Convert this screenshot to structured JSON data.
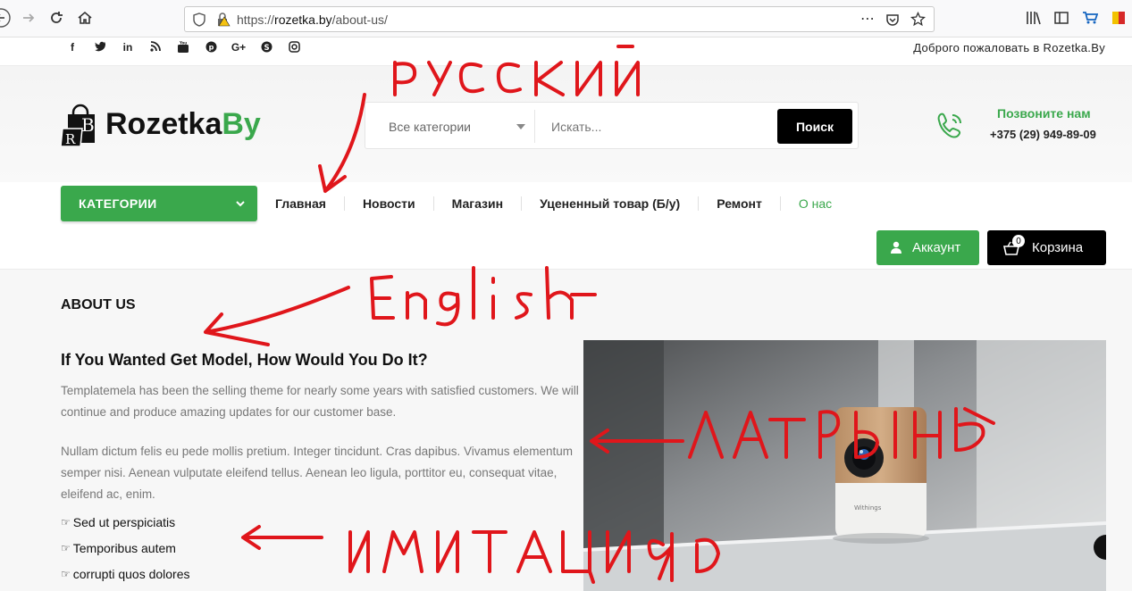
{
  "browser": {
    "url_prefix": "https://",
    "url_host": "rozetka.by",
    "url_path": "/about-us/",
    "more_icon": "⋯"
  },
  "topbar": {
    "social": [
      "f",
      "t",
      "in",
      "rss",
      "yt",
      "p",
      "G+",
      "s",
      "ig"
    ],
    "welcome": "Доброго пожаловать в Rozetka.By"
  },
  "header": {
    "logo_main": "Rozetka",
    "logo_accent": "By",
    "logo_bag_letters": [
      "R",
      "B"
    ],
    "search": {
      "category": "Все категории",
      "placeholder": "Искать...",
      "button": "Поиск"
    },
    "call_label": "Позвоните нам",
    "phone": "+375 (29) 949-89-09"
  },
  "nav": {
    "categories": "КАТЕГОРИИ",
    "items": [
      "Главная",
      "Новости",
      "Магазин",
      "Уцененный товар (Б/у)",
      "Ремонт",
      "О нас"
    ],
    "account": "Аккаунт",
    "cart": "Корзина",
    "cart_count": "0"
  },
  "content": {
    "section_title": "ABOUT US",
    "heading": "If You Wanted Get Model, How Would You Do It?",
    "para1": "Templatemela has been the selling theme for nearly some years with satisfied customers. We will continue and produce amazing updates for our customer base.",
    "para2": "Nullam dictum felis eu pede mollis pretium. Integer tincidunt. Cras dapibus. Vivamus elementum semper nisi. Aenean vulputate eleifend tellus. Aenean leo ligula, porttitor eu, consequat vitae, eleifend ac, enim.",
    "bullets": [
      "Sed ut perspiciatis",
      "Temporibus autem",
      "corrupti quos dolores"
    ],
    "camera_brand": "Withings"
  },
  "annotations": {
    "color": "#e0161b",
    "labels": [
      "РУССКИЙ",
      "English",
      "ЛАТЫНЬ",
      "ИМИТАЦИЯ"
    ]
  }
}
